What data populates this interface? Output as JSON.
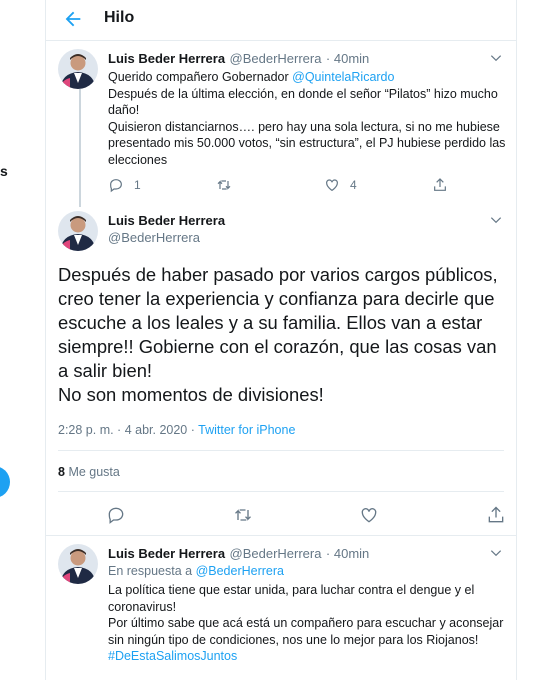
{
  "header": {
    "title": "Hilo"
  },
  "left": {
    "fragment": "s"
  },
  "tweet1": {
    "name": "Luis Beder Herrera",
    "handle": "@BederHerrera",
    "time": "40min",
    "line1_prefix": "Querido compañero Gobernador ",
    "mention": "@QuintelaRicardo",
    "text": "Después de la última elección, en donde el señor “Pilatos” hizo mucho daño!\nQuisieron distanciarnos…. pero hay una sola lectura,  si no me hubiese presentado mis 50.000 votos, “sin estructura”, el PJ hubiese perdido las elecciones",
    "replies": "1",
    "retweets": "",
    "likes": "4"
  },
  "tweet2": {
    "name": "Luis Beder Herrera",
    "handle": "@BederHerrera",
    "text": "Después de haber pasado por varios cargos públicos, creo tener la experiencia y confianza para decirle que escuche a los leales y a su familia. Ellos van a estar siempre!! Gobierne con el corazón, que las cosas van a salir bien!\nNo son momentos de divisiones!",
    "timestamp": "2:28 p. m. · 4 abr. 2020 · ",
    "source": "Twitter for iPhone",
    "likes_count": "8",
    "likes_label": "Me gusta"
  },
  "tweet3": {
    "name": "Luis Beder Herrera",
    "handle": "@BederHerrera",
    "time": "40min",
    "reply_prefix": "En respuesta a ",
    "reply_to": "@BederHerrera",
    "text": "La política tiene que estar unida, para luchar contra el dengue y el coronavirus!\nPor último sabe que acá está un compañero para escuchar y aconsejar sin ningún tipo de condiciones, nos une lo mejor para los Riojanos!",
    "hashtag": "#DeEstaSalimosJuntos"
  },
  "colors": {
    "accent": "#1da1f2",
    "muted": "#657786",
    "text": "#14171a",
    "border": "#e6ecf0"
  }
}
